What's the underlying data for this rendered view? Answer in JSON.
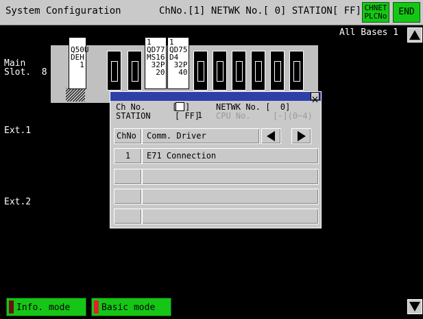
{
  "header": {
    "title": "System Configuration",
    "info": "ChNo.[1] NETWK No.[ 0] STATION[ FF]",
    "chnet_button": "CHNET\nPLCNo",
    "end_button": "END"
  },
  "all_bases": "All Bases 1",
  "labels": {
    "main": "Main\nSlot.  8",
    "ext1": "Ext.1",
    "ext2": "Ext.2"
  },
  "modules": [
    {
      "text": "\nQ50U\nDEH\n  1"
    },
    {
      "text": "1\nQD77\nMS16\n 32P\n  20"
    },
    {
      "text": "1\nQD75\nD4\n 32P\n  40"
    }
  ],
  "dialog": {
    "ch_no_label": "Ch No.",
    "ch_no_value": "1",
    "netwk_label": "NETWK No. [  0]",
    "station_label": "STATION",
    "station_value": "[ FF]",
    "cpu_label": "CPU No.",
    "cpu_value": "[-](0~4)",
    "table": {
      "headers": [
        "ChNo",
        "Comm. Driver"
      ],
      "rows": [
        {
          "chno": "1",
          "driver": "E71 Connection"
        },
        {
          "chno": "",
          "driver": ""
        },
        {
          "chno": "",
          "driver": ""
        },
        {
          "chno": "",
          "driver": ""
        }
      ]
    }
  },
  "buttons": {
    "info_mode": "Info. mode",
    "basic_mode": "Basic mode"
  },
  "colors": {
    "accent_green": "#16c616",
    "dialog_title_blue": "#2e3fa8",
    "indicator_red": "#e0202a",
    "indicator_dark_red": "#6a1010"
  }
}
